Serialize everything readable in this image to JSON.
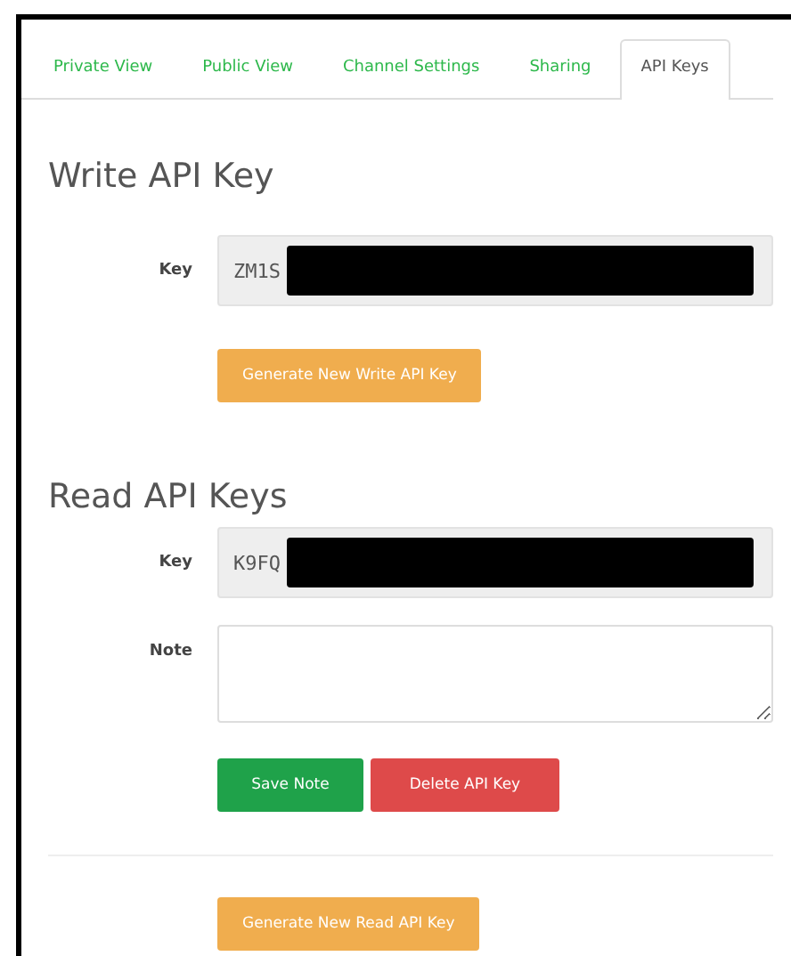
{
  "tabs": [
    {
      "label": "Private View",
      "selected": false
    },
    {
      "label": "Public View",
      "selected": false
    },
    {
      "label": "Channel Settings",
      "selected": false
    },
    {
      "label": "Sharing",
      "selected": false
    },
    {
      "label": "API Keys",
      "selected": true
    }
  ],
  "write_section": {
    "title": "Write API Key",
    "key_label": "Key",
    "key_value": "ZM1S",
    "redacted": true,
    "button": "Generate New Write API Key"
  },
  "read_section": {
    "title": "Read API Keys",
    "key_label": "Key",
    "key_value": "K9FQ",
    "redacted": true,
    "note_label": "Note",
    "buttons": [
      {
        "label": "Save Note",
        "kind": "success"
      },
      {
        "label": "Delete API Key",
        "kind": "danger"
      }
    ],
    "generate_button": "Generate New Read API Key"
  }
}
